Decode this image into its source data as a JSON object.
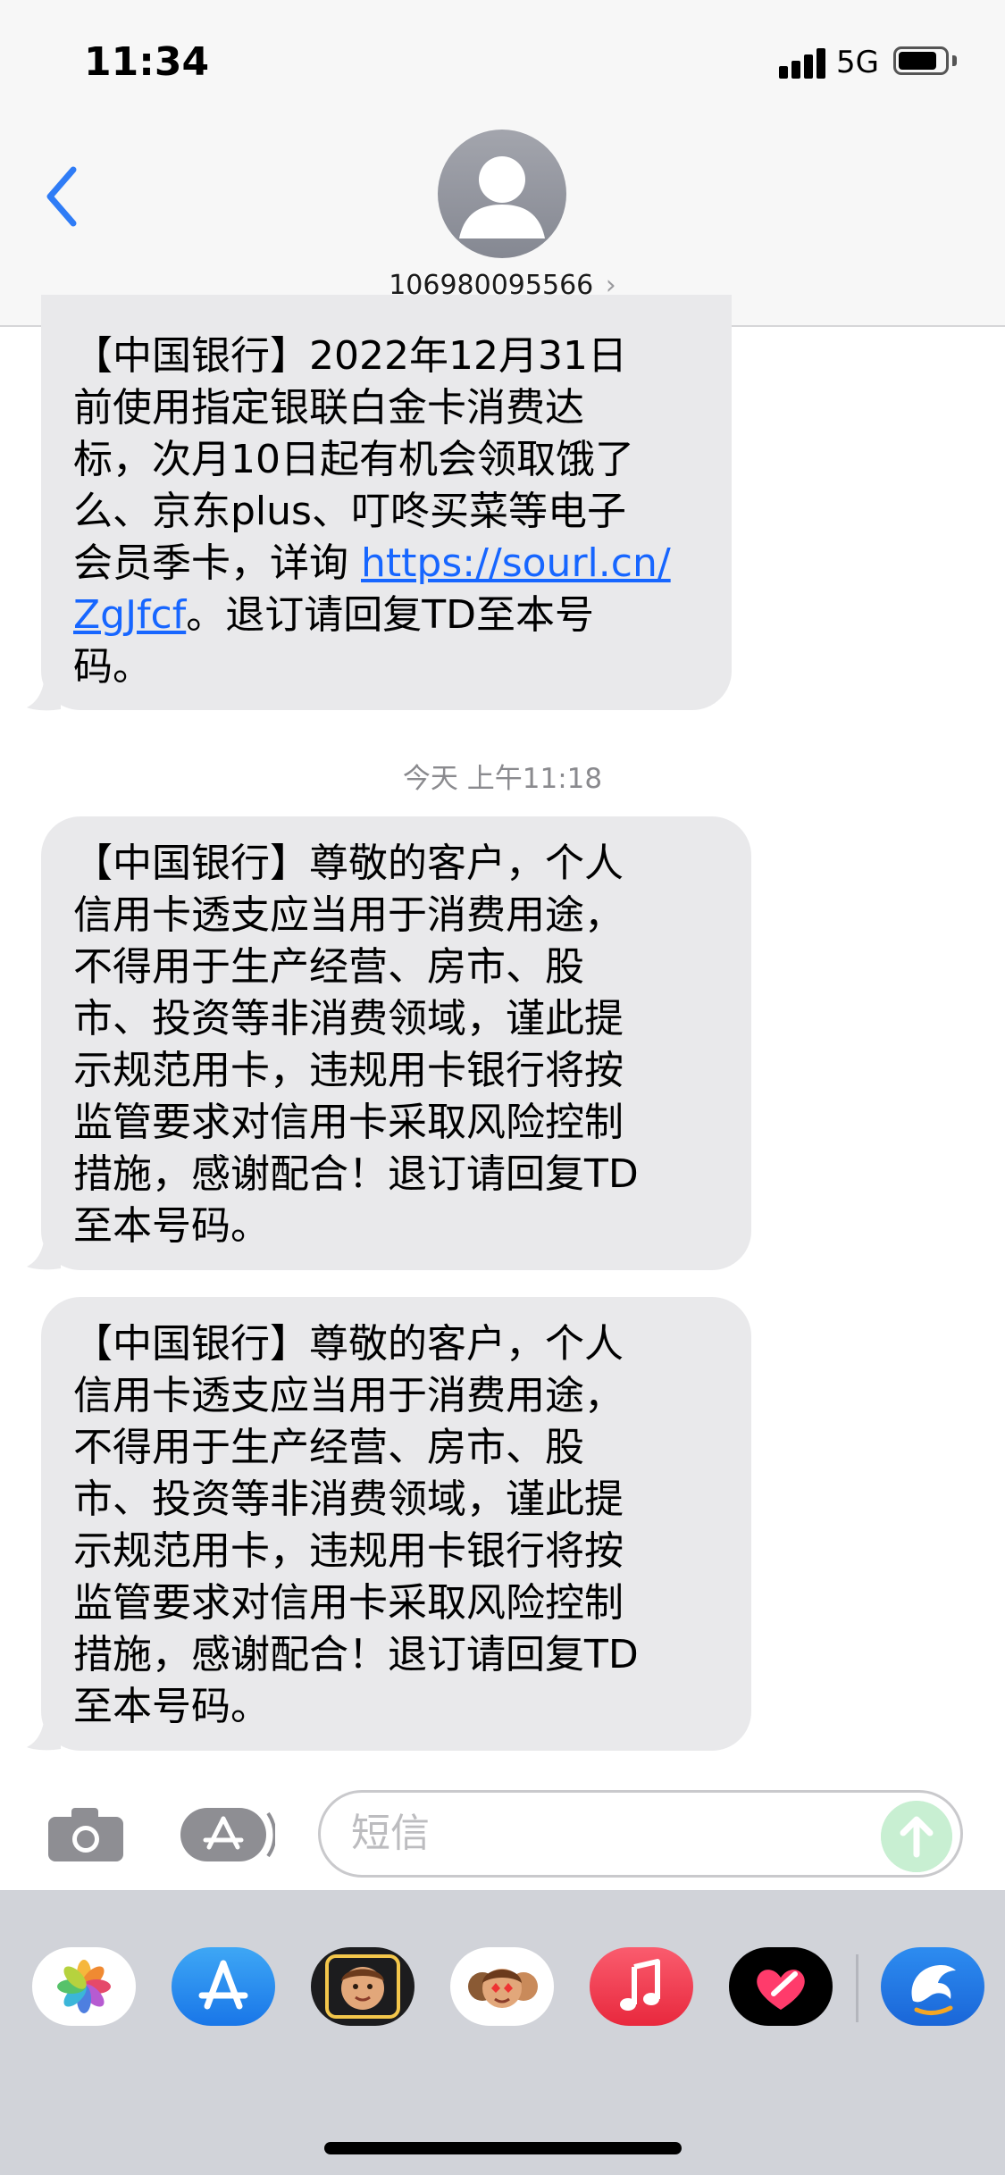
{
  "status_bar": {
    "time": "11:34",
    "network": "5G"
  },
  "header": {
    "contact": "106980095566",
    "contact_chevron": "›"
  },
  "messages": [
    {
      "text_before_link": "【中国银行】2022年12月31日\n前使用指定银联白金卡消费达\n标，次月10日起有机会领取饿了\n么、京东plus、叮咚买菜等电子\n会员季卡，详询 ",
      "link_text": "https://sourl.cn/\nZgJfcf",
      "text_after_link": "。退订请回复TD至本号\n码。"
    },
    {
      "text": "【中国银行】尊敬的客户，个人\n信用卡透支应当用于消费用途，\n不得用于生产经营、房市、股\n市、投资等非消费领域，谨此提\n示规范用卡，违规用卡银行将按\n监管要求对信用卡采取风险控制\n措施，感谢配合！退订请回复TD\n至本号码。"
    },
    {
      "text": "【中国银行】尊敬的客户，个人\n信用卡透支应当用于消费用途，\n不得用于生产经营、房市、股\n市、投资等非消费领域，谨此提\n示规范用卡，违规用卡银行将按\n监管要求对信用卡采取风险控制\n措施，感谢配合！退订请回复TD\n至本号码。"
    }
  ],
  "timestamp": "今天 上午11:18",
  "input": {
    "placeholder": "短信"
  },
  "colors": {
    "link": "#1766ff",
    "back": "#2f7cf6",
    "bubble": "#e9e9eb"
  },
  "app_drawer": [
    "photos-icon",
    "app-store-icon",
    "memoji-icon",
    "animoji-icon",
    "music-icon",
    "digital-touch-icon",
    "dolphin-app-icon"
  ]
}
